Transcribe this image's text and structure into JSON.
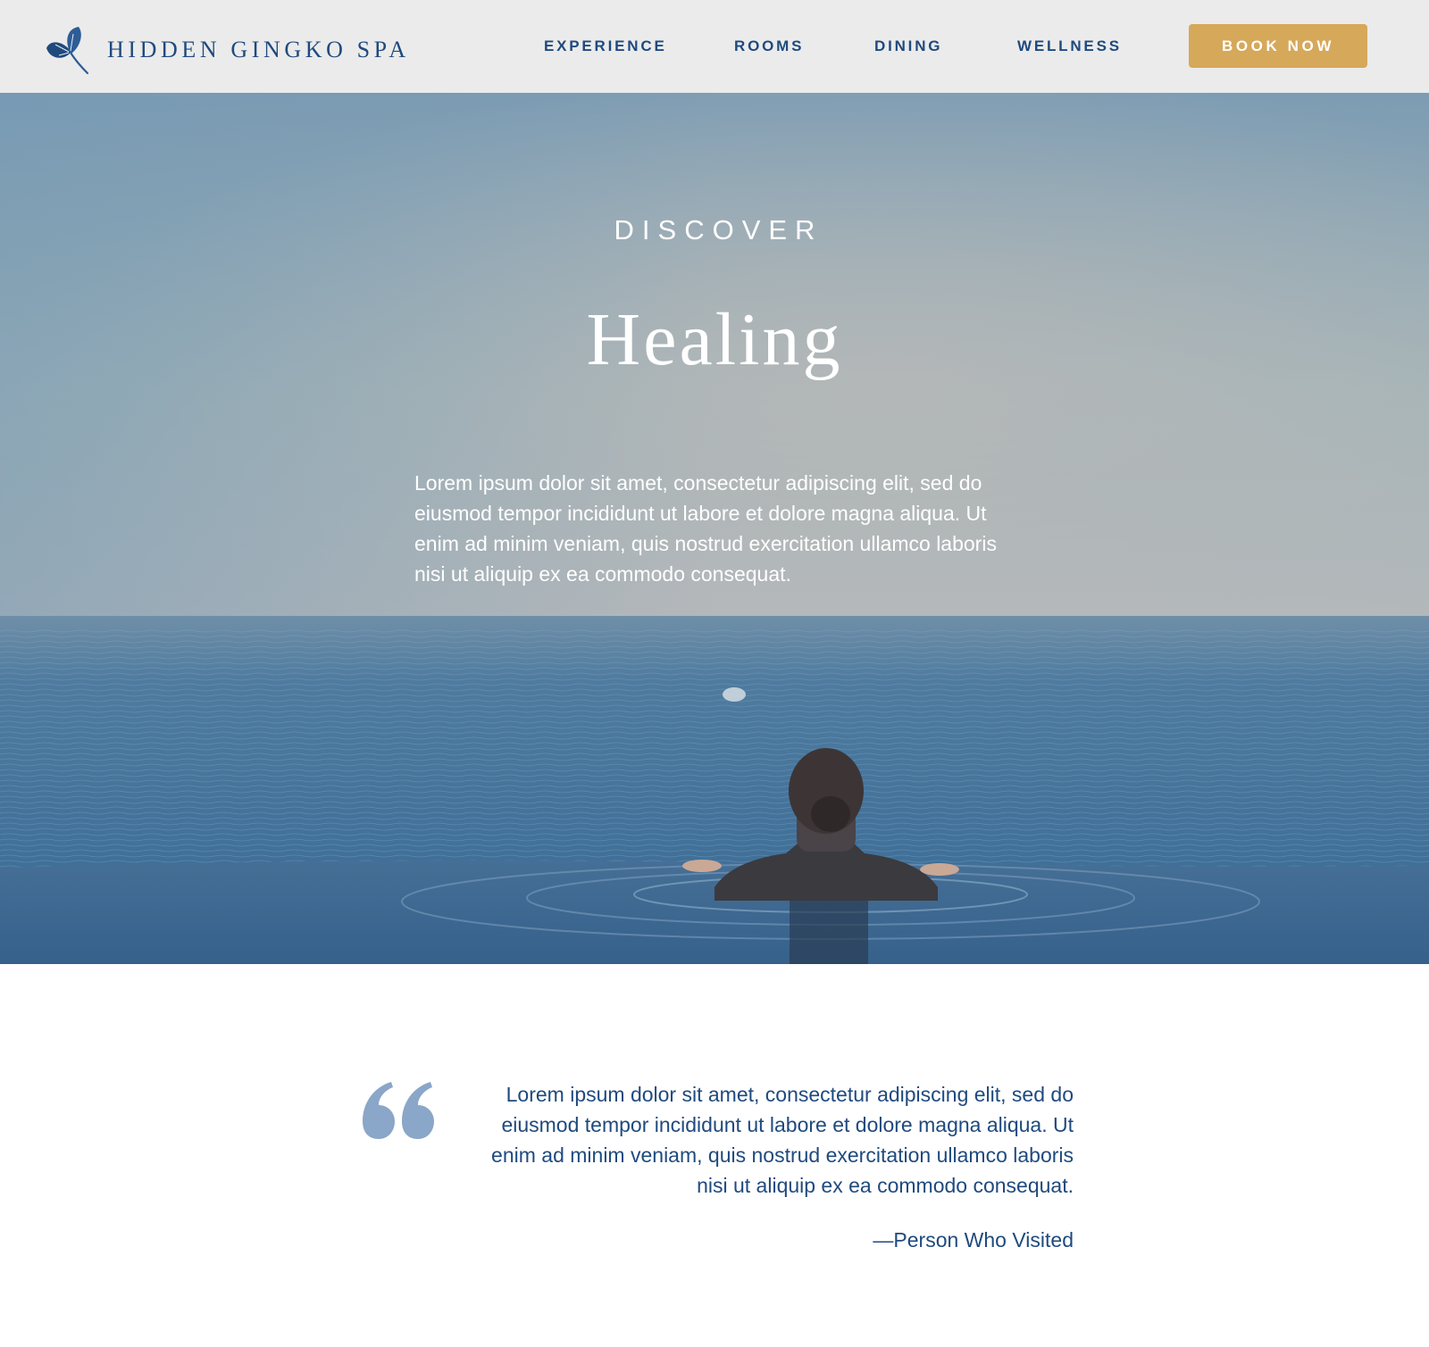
{
  "brand": {
    "name": "HIDDEN GINGKO SPA",
    "icon": "ginkgo-leaf-icon"
  },
  "nav": {
    "items": [
      {
        "label": "EXPERIENCE"
      },
      {
        "label": "ROOMS"
      },
      {
        "label": "DINING"
      },
      {
        "label": "WELLNESS"
      }
    ],
    "cta_label": "BOOK NOW"
  },
  "hero": {
    "eyebrow": "DISCOVER",
    "title": "Healing",
    "body": "Lorem ipsum dolor sit amet, consectetur adipiscing elit, sed do eiusmod tempor incididunt ut labore et dolore magna aliqua. Ut enim ad minim veniam, quis nostrud exercitation ullamco laboris nisi ut aliquip ex ea commodo consequat."
  },
  "testimonial": {
    "quote": "Lorem ipsum dolor sit amet, consectetur adipiscing elit, sed do eiusmod tempor incididunt ut labore et dolore magna aliqua. Ut enim ad minim veniam, quis nostrud exercitation ullamco laboris nisi ut aliquip ex ea commodo consequat.",
    "author": "—Person Who Visited",
    "icon": "quote-mark-icon"
  },
  "colors": {
    "header_bg": "#ebebeb",
    "brand_blue": "#1f4a7e",
    "accent_gold": "#d6a85a",
    "quote_mark": "#8aa6c8",
    "page_bg": "#ffffff"
  }
}
